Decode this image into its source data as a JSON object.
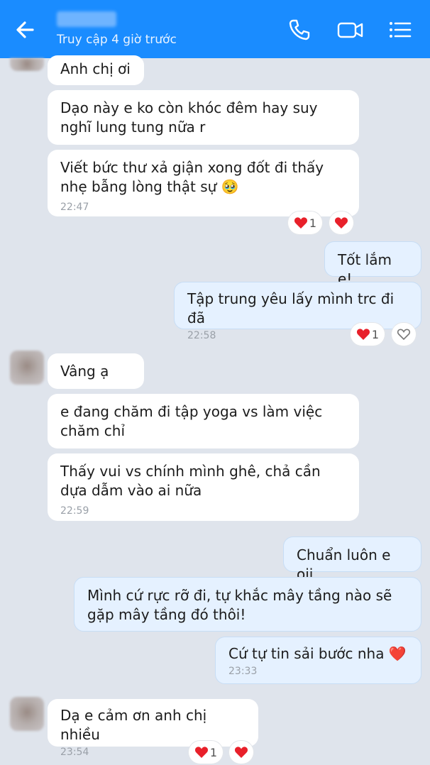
{
  "header": {
    "subtitle": "Truy cập 4 giờ trước",
    "icons": [
      "back-arrow-icon",
      "phone-icon",
      "video-call-icon",
      "menu-list-icon"
    ]
  },
  "colors": {
    "header": "#1a8cff",
    "background": "#dfe4ec",
    "incoming": "#ffffff",
    "outgoing": "#e5f1ff",
    "heart": "#e8202a"
  },
  "messages": [
    {
      "text": "Anh chị ơi"
    },
    {
      "text": "Dạo này e ko còn khóc đêm hay suy nghĩ lung tung nữa r"
    },
    {
      "text": "Viết bức thư xả giận xong đốt đi thấy nhẹ bẫng lòng thật sự 🥹",
      "time": "22:47",
      "reaction_count": "1"
    },
    {
      "text": "Tốt lắm e!"
    },
    {
      "text": "Tập trung yêu lấy mình trc đi đã",
      "time": "22:58",
      "reaction_count": "1"
    },
    {
      "text": "Vâng ạ"
    },
    {
      "text": "e đang chăm đi tập yoga vs làm việc chăm chỉ"
    },
    {
      "text": "Thấy vui vs chính mình ghê, chả cần dựa dẫm vào ai nữa",
      "time": "22:59"
    },
    {
      "text": "Chuẩn luôn e oii"
    },
    {
      "text": "Mình cứ rực rỡ đi, tự khắc mây tầng nào sẽ gặp mây tầng đó thôi!"
    },
    {
      "text": "Cứ tự tin sải bước nha ❤️",
      "time": "23:33"
    },
    {
      "text": "Dạ e cảm ơn anh chị nhiều",
      "time": "23:54",
      "reaction_count": "1"
    }
  ]
}
